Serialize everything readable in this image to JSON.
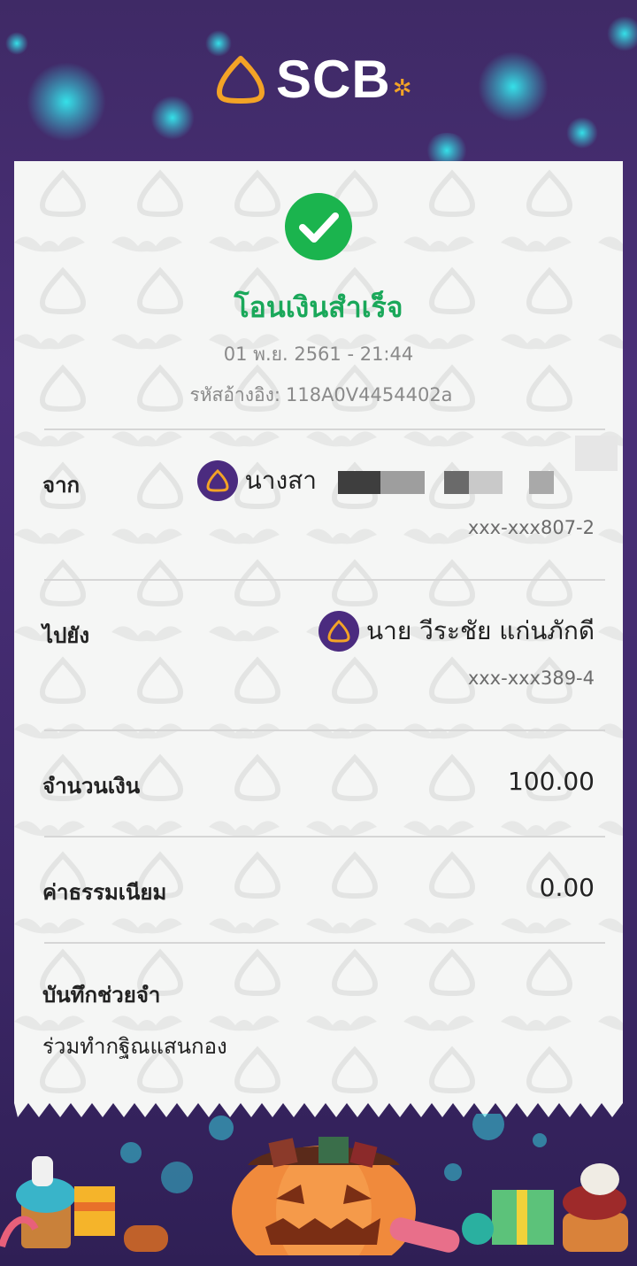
{
  "header": {
    "logo_text": "SCB",
    "logo_star": "✲"
  },
  "status": {
    "title": "โอนเงินสำเร็จ",
    "datetime": "01 พ.ย. 2561 - 21:44",
    "ref_label": "รหัสอ้างอิง:",
    "ref_value": "118A0V4454402a"
  },
  "from": {
    "label": "จาก",
    "name": "นางสา",
    "account": "xxx-xxx807-2",
    "icon": "scb-bank-icon"
  },
  "to": {
    "label": "ไปยัง",
    "name": "นาย วีระชัย แก่นภักดี",
    "account": "xxx-xxx389-4",
    "icon": "scb-bank-icon"
  },
  "amount": {
    "label": "จำนวนเงิน",
    "value": "100.00"
  },
  "fee": {
    "label": "ค่าธรรมเนียม",
    "value": "0.00"
  },
  "note": {
    "label": "บันทึกช่วยจำ",
    "value": "ร่วมทำกฐิณแสนกอง"
  },
  "colors": {
    "success": "#1bb44e",
    "brand_purple": "#4b2b7f",
    "brand_gold": "#f3a326"
  }
}
